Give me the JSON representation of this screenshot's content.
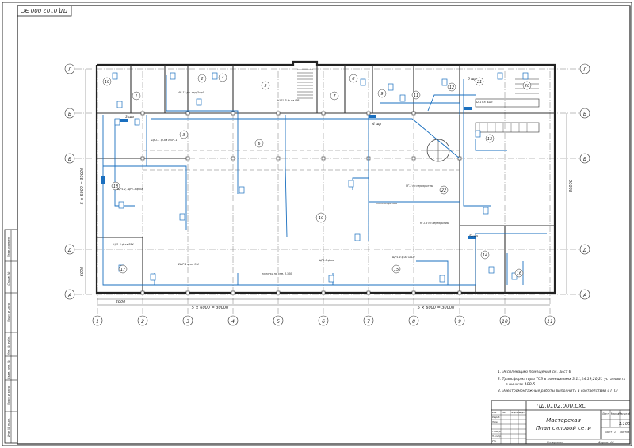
{
  "stamp_code": "ПД.0102.000.ЭС",
  "doc_code": "ПД.0102.000.СхС",
  "titles": {
    "line1": "Мастерская",
    "line2": "План силовой сети"
  },
  "scale": "1:100",
  "sheet_label": "Лист",
  "sheets_label": "Листов",
  "mass_label": "Масса",
  "scale_label": "Масштаб",
  "sheet_num": "1",
  "sheets_total": "1",
  "copied": "Копировал",
  "format": "Формат   А1",
  "tb_rows": [
    "Изм",
    "Лист",
    "№ докум.",
    "Подп.",
    "Дата"
  ],
  "tb_roles": [
    "Разраб.",
    "Пров.",
    "Т.контр.",
    "Н.контр.",
    "Утв."
  ],
  "notes": [
    "1. Экспликацию помещений см. лист 6",
    "2. Трансформаторы ТСЗ в помещениях 3,11,14,19,20,21 установить",
    "в нишках ABB-5",
    "3. Электромонтажные работы выполнить в соответствии с ГПЭ"
  ],
  "axis_cols": [
    "1",
    "2",
    "3",
    "4",
    "5",
    "6",
    "7",
    "8",
    "9",
    "10",
    "11"
  ],
  "axis_rows": [
    "Г",
    "В",
    "Б",
    "Д",
    "А"
  ],
  "dims": {
    "bottom_left": "6000",
    "bottom_mid": "5 × 6000 = 30000",
    "bottom_right": "5 × 6000 = 30000",
    "left_vert": "5 × 6000 = 30000",
    "left_small": "6000",
    "right_vert": "30000"
  },
  "side_stamp": [
    "Инв. № подл.",
    "Подп. и дата",
    "Взам. инв. №",
    "Инв. № дубл.",
    "Подп. и дата",
    "Справ. №",
    "Перв. примен."
  ],
  "room_numbers": [
    "1",
    "2",
    "3",
    "4",
    "5",
    "6",
    "7",
    "8",
    "9",
    "10",
    "11",
    "12",
    "13",
    "14",
    "15",
    "16",
    "17",
    "18",
    "19",
    "20",
    "21",
    "22"
  ],
  "labels": [
    "ШР1-3 ф-ка ПВ",
    "3 шр",
    "ЩР1-1 ф-ка ВПН-1",
    "ЩР1-2, ЩР1-3 ф-ка",
    "АВ 12 рп. над 3шр1",
    "6 шр",
    "4 шр",
    "5 шр",
    "ЩР1-4 ф-ка ЩСП",
    "по перекрытию",
    "ПГ-3 по перекрытию",
    "НГ1-3 по перекрытию",
    "А2-1 бл. 4шр",
    "ЩР1-2 ф-ка ВРУ",
    "2ШР-1 ф-ка Э-4",
    "ЩР1-5 ф-ка",
    "по лотку на отм. 3.300"
  ]
}
